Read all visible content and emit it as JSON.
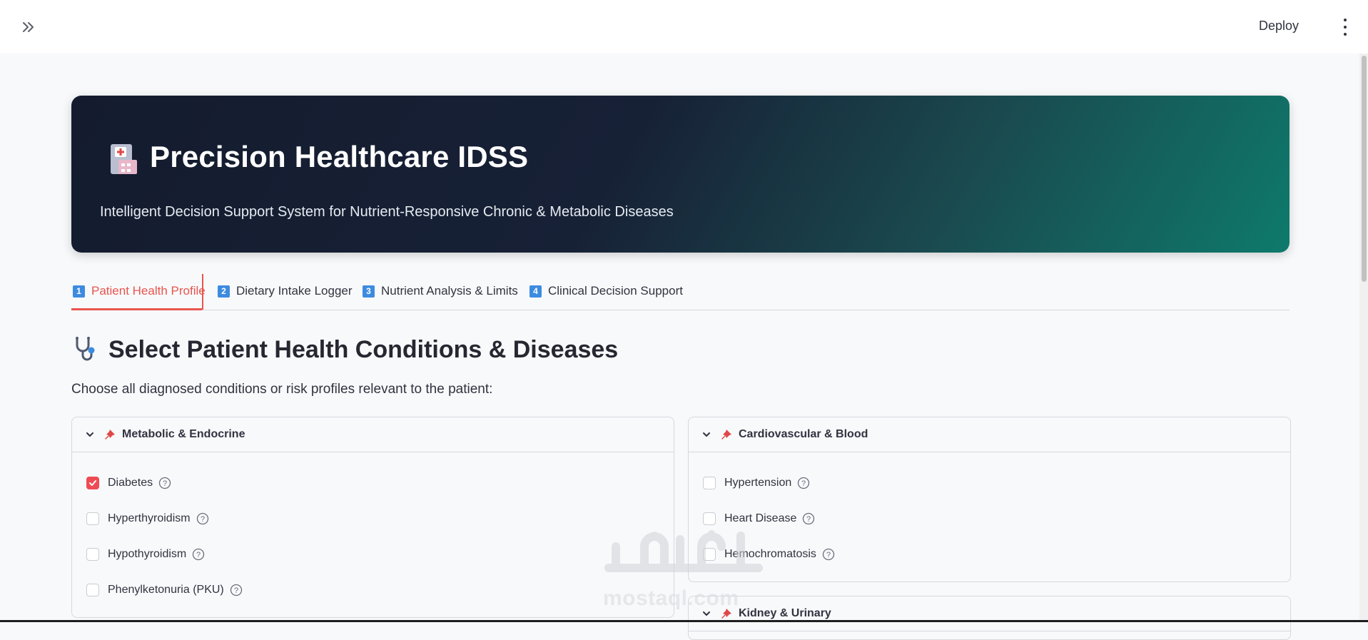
{
  "topbar": {
    "deploy_label": "Deploy"
  },
  "hero": {
    "title": "Precision Healthcare IDSS",
    "subtitle": "Intelligent Decision Support System for Nutrient-Responsive Chronic & Metabolic Diseases",
    "icon": "hospital-icon"
  },
  "tabs": [
    {
      "num": "1",
      "label": "Patient Health Profile",
      "active": true
    },
    {
      "num": "2",
      "label": "Dietary Intake Logger"
    },
    {
      "num": "3",
      "label": "Nutrient Analysis & Limits"
    },
    {
      "num": "4",
      "label": "Clinical Decision Support"
    }
  ],
  "section": {
    "title": "Select Patient Health Conditions & Diseases",
    "description": "Choose all diagnosed conditions or risk profiles relevant to the patient:",
    "icon": "stethoscope-icon"
  },
  "panels": [
    {
      "title": "Metabolic & Endocrine",
      "options": [
        {
          "label": "Diabetes",
          "checked": true
        },
        {
          "label": "Hyperthyroidism",
          "checked": false
        },
        {
          "label": "Hypothyroidism",
          "checked": false
        },
        {
          "label": "Phenylketonuria (PKU)",
          "checked": false
        }
      ]
    },
    {
      "title": "Cardiovascular & Blood",
      "options": [
        {
          "label": "Hypertension",
          "checked": false
        },
        {
          "label": "Heart Disease",
          "checked": false
        },
        {
          "label": "Hemochromatosis",
          "checked": false
        }
      ]
    },
    {
      "title": "Kidney & Urinary",
      "options": []
    }
  ],
  "watermark": {
    "arabic": "مستقل",
    "text": "mostaql.com"
  },
  "colors": {
    "accent": "#e8554e",
    "checkbox_checked": "#ef4b55",
    "tab_num": "#3d8be0"
  }
}
